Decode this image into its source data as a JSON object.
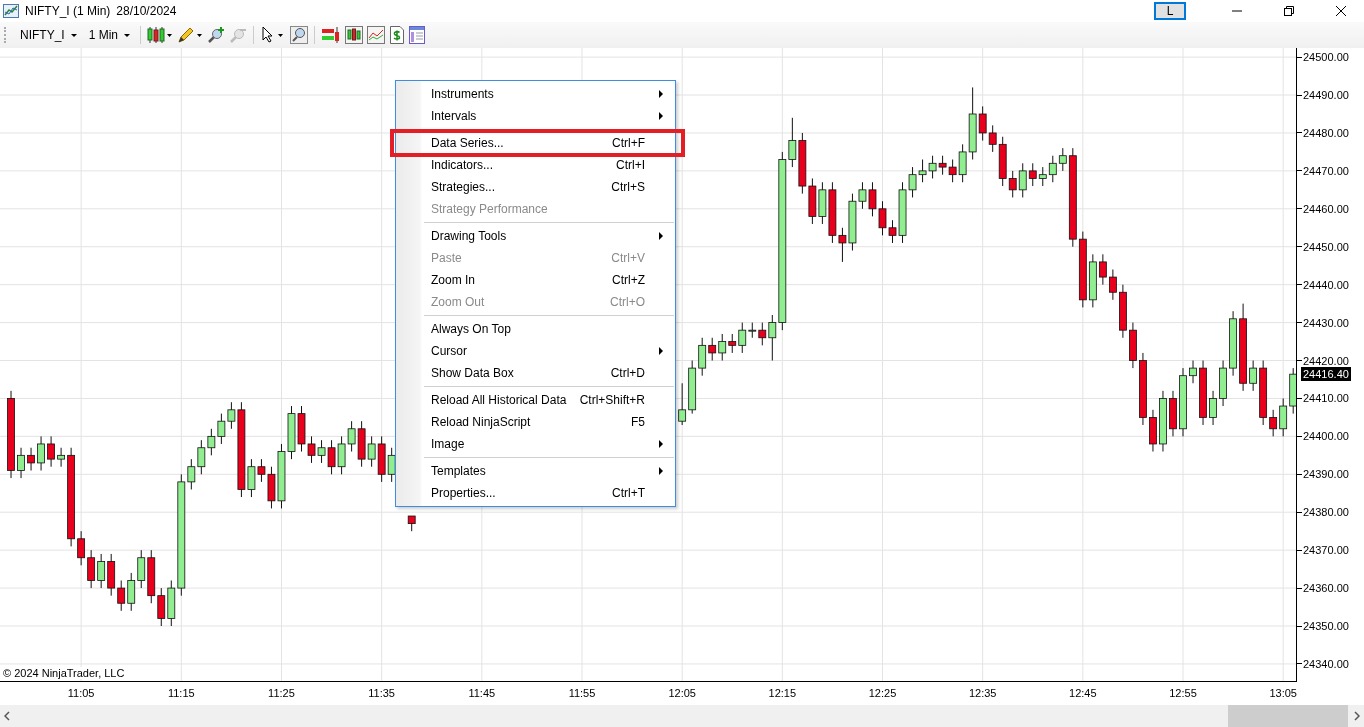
{
  "window": {
    "title": "NIFTY_I (1 Min)",
    "date": "28/10/2024",
    "account_button": "L"
  },
  "toolbar": {
    "instrument": "NIFTY_I",
    "interval": "1 Min"
  },
  "chart": {
    "current_price": "24416.40",
    "copyright": "© 2024 NinjaTrader, LLC",
    "chart_data": {
      "type": "candlestick",
      "x": [
        658,
        659,
        660,
        661,
        662,
        663,
        664,
        665,
        666,
        667,
        668,
        669,
        670,
        671,
        672,
        673,
        674,
        675,
        676,
        677,
        678,
        679,
        680,
        681,
        682,
        683,
        684,
        685,
        686,
        687,
        688,
        689,
        690,
        691,
        692,
        693,
        694,
        695,
        696,
        698,
        725,
        726,
        727,
        728,
        729,
        730,
        731,
        732,
        733,
        734,
        735,
        736,
        737,
        738,
        739,
        740,
        741,
        742,
        743,
        744,
        745,
        746,
        747,
        748,
        749,
        750,
        751,
        752,
        753,
        754,
        755,
        756,
        757,
        758,
        759,
        760,
        761,
        762,
        763,
        764,
        765,
        766,
        767,
        768,
        769,
        770,
        771,
        772,
        773,
        774,
        775,
        776,
        777,
        778,
        779,
        780,
        781,
        782,
        783,
        784,
        785,
        786
      ],
      "ohlc": [
        [
          24410,
          24412,
          24389,
          24391
        ],
        [
          24391,
          24397,
          24389,
          24395
        ],
        [
          24395,
          24397,
          24391,
          24393
        ],
        [
          24393,
          24400,
          24391,
          24398
        ],
        [
          24398,
          24400,
          24392,
          24394
        ],
        [
          24394,
          24397,
          24392,
          24395
        ],
        [
          24395,
          24397,
          24371,
          24373
        ],
        [
          24373,
          24375,
          24366,
          24368
        ],
        [
          24368,
          24370,
          24360,
          24362
        ],
        [
          24362,
          24369,
          24360,
          24367
        ],
        [
          24367,
          24369,
          24358,
          24360
        ],
        [
          24360,
          24362,
          24354,
          24356
        ],
        [
          24356,
          24364,
          24354,
          24362
        ],
        [
          24362,
          24370,
          24360,
          24368
        ],
        [
          24368,
          24370,
          24356,
          24358
        ],
        [
          24358,
          24360,
          24350,
          24352
        ],
        [
          24352,
          24362,
          24350,
          24360
        ],
        [
          24360,
          24390,
          24358,
          24388
        ],
        [
          24388,
          24394,
          24386,
          24392
        ],
        [
          24392,
          24399,
          24390,
          24397
        ],
        [
          24397,
          24402,
          24395,
          24400
        ],
        [
          24400,
          24406,
          24398,
          24404
        ],
        [
          24404,
          24409,
          24402,
          24407
        ],
        [
          24407,
          24409,
          24384,
          24386
        ],
        [
          24386,
          24394,
          24384,
          24392
        ],
        [
          24392,
          24394,
          24388,
          24390
        ],
        [
          24390,
          24392,
          24381,
          24383
        ],
        [
          24383,
          24398,
          24381,
          24396
        ],
        [
          24396,
          24408,
          24394,
          24406
        ],
        [
          24406,
          24408,
          24396,
          24398
        ],
        [
          24398,
          24400,
          24393,
          24395
        ],
        [
          24395,
          24399,
          24393,
          24397
        ],
        [
          24397,
          24399,
          24390,
          24392
        ],
        [
          24392,
          24400,
          24390,
          24398
        ],
        [
          24398,
          24404,
          24396,
          24402
        ],
        [
          24402,
          24404,
          24392,
          24394
        ],
        [
          24394,
          24400,
          24392,
          24398
        ],
        [
          24398,
          24400,
          24388,
          24390
        ],
        [
          24390,
          24397,
          24388,
          24395
        ],
        [
          24379,
          24379,
          24375,
          24377
        ],
        [
          24404,
          24414,
          24403,
          24407
        ],
        [
          24407,
          24420,
          24406,
          24418
        ],
        [
          24418,
          24426,
          24416,
          24424
        ],
        [
          24424,
          24426,
          24420,
          24422
        ],
        [
          24422,
          24427,
          24420,
          24425
        ],
        [
          24425,
          24427,
          24422,
          24424
        ],
        [
          24424,
          24430,
          24422,
          24428
        ],
        [
          24428,
          24430,
          24426,
          24428
        ],
        [
          24428,
          24430,
          24424,
          24426
        ],
        [
          24426,
          24432,
          24420,
          24430
        ],
        [
          24430,
          24475,
          24428,
          24473
        ],
        [
          24473,
          24484,
          24471,
          24478
        ],
        [
          24478,
          24480,
          24464,
          24466
        ],
        [
          24466,
          24468,
          24456,
          24458
        ],
        [
          24458,
          24467,
          24456,
          24465
        ],
        [
          24465,
          24467,
          24451,
          24453
        ],
        [
          24453,
          24455,
          24446,
          24451
        ],
        [
          24451,
          24464,
          24449,
          24462
        ],
        [
          24462,
          24467,
          24460,
          24465
        ],
        [
          24465,
          24467,
          24458,
          24460
        ],
        [
          24460,
          24462,
          24453,
          24455
        ],
        [
          24455,
          24457,
          24451,
          24453
        ],
        [
          24453,
          24467,
          24451,
          24465
        ],
        [
          24465,
          24471,
          24463,
          24469
        ],
        [
          24469,
          24473,
          24467,
          24470
        ],
        [
          24470,
          24474,
          24468,
          24472
        ],
        [
          24472,
          24474,
          24469,
          24471
        ],
        [
          24471,
          24473,
          24467,
          24469
        ],
        [
          24469,
          24477,
          24467,
          24475
        ],
        [
          24475,
          24492,
          24473,
          24485
        ],
        [
          24485,
          24487,
          24478,
          24480
        ],
        [
          24480,
          24482,
          24475,
          24477
        ],
        [
          24477,
          24479,
          24466,
          24468
        ],
        [
          24468,
          24470,
          24463,
          24465
        ],
        [
          24465,
          24472,
          24463,
          24470
        ],
        [
          24470,
          24472,
          24466,
          24468
        ],
        [
          24468,
          24471,
          24466,
          24469
        ],
        [
          24469,
          24474,
          24467,
          24472
        ],
        [
          24472,
          24476,
          24470,
          24474
        ],
        [
          24474,
          24476,
          24450,
          24452
        ],
        [
          24452,
          24454,
          24434,
          24436
        ],
        [
          24436,
          24448,
          24434,
          24446
        ],
        [
          24446,
          24448,
          24440,
          24442
        ],
        [
          24442,
          24444,
          24436,
          24438
        ],
        [
          24438,
          24440,
          24426,
          24428
        ],
        [
          24428,
          24430,
          24418,
          24420
        ],
        [
          24420,
          24422,
          24403,
          24405
        ],
        [
          24405,
          24407,
          24396,
          24398
        ],
        [
          24398,
          24412,
          24396,
          24410
        ],
        [
          24410,
          24412,
          24400,
          24402
        ],
        [
          24402,
          24418,
          24400,
          24416
        ],
        [
          24416,
          24420,
          24414,
          24418
        ],
        [
          24418,
          24420,
          24403,
          24405
        ],
        [
          24405,
          24412,
          24403,
          24410
        ],
        [
          24410,
          24420,
          24408,
          24418
        ],
        [
          24418,
          24433,
          24416,
          24431
        ],
        [
          24431,
          24435,
          24412,
          24414
        ],
        [
          24414,
          24420,
          24412,
          24418
        ],
        [
          24418,
          24420,
          24403,
          24405
        ],
        [
          24405,
          24407,
          24400,
          24402
        ],
        [
          24402,
          24410,
          24400,
          24408
        ],
        [
          24408,
          24418,
          24406,
          24416.4
        ]
      ],
      "xlim": [
        656.9,
        786.38
      ],
      "ylim": [
        24335.5,
        24502.4
      ],
      "grid": true,
      "xticks": [
        {
          "value": 665,
          "label": "11:05"
        },
        {
          "value": 675,
          "label": "11:15"
        },
        {
          "value": 685,
          "label": "11:25"
        },
        {
          "value": 695,
          "label": "11:35"
        },
        {
          "value": 705,
          "label": "11:45"
        },
        {
          "value": 715,
          "label": "11:55"
        },
        {
          "value": 725,
          "label": "12:05"
        },
        {
          "value": 735,
          "label": "12:15"
        },
        {
          "value": 745,
          "label": "12:25"
        },
        {
          "value": 755,
          "label": "12:35"
        },
        {
          "value": 765,
          "label": "12:45"
        },
        {
          "value": 775,
          "label": "12:55"
        },
        {
          "value": 785,
          "label": "13:05"
        }
      ],
      "yticks": [
        {
          "value": 24500,
          "label": "24500.00"
        },
        {
          "value": 24490,
          "label": "24490.00"
        },
        {
          "value": 24480,
          "label": "24480.00"
        },
        {
          "value": 24470,
          "label": "24470.00"
        },
        {
          "value": 24460,
          "label": "24460.00"
        },
        {
          "value": 24450,
          "label": "24450.00"
        },
        {
          "value": 24440,
          "label": "24440.00"
        },
        {
          "value": 24430,
          "label": "24430.00"
        },
        {
          "value": 24420,
          "label": "24420.00"
        },
        {
          "value": 24410,
          "label": "24410.00"
        },
        {
          "value": 24400,
          "label": "24400.00"
        },
        {
          "value": 24390,
          "label": "24390.00"
        },
        {
          "value": 24380,
          "label": "24380.00"
        },
        {
          "value": 24370,
          "label": "24370.00"
        },
        {
          "value": 24360,
          "label": "24360.00"
        },
        {
          "value": 24350,
          "label": "24350.00"
        },
        {
          "value": 24340,
          "label": "24340.00"
        }
      ]
    }
  },
  "context_menu": {
    "sections": [
      [
        {
          "label": "Instruments",
          "submenu": true,
          "disabled": false,
          "highlighted": false
        },
        {
          "label": "Intervals",
          "submenu": true,
          "disabled": false,
          "highlighted": false
        }
      ],
      [
        {
          "label": "Data Series...",
          "shortcut": "Ctrl+F",
          "submenu": false,
          "disabled": false,
          "highlighted": true
        },
        {
          "label": "Indicators...",
          "shortcut": "Ctrl+I",
          "submenu": false,
          "disabled": false,
          "highlighted": false
        },
        {
          "label": "Strategies...",
          "shortcut": "Ctrl+S",
          "submenu": false,
          "disabled": false,
          "highlighted": false
        },
        {
          "label": "Strategy Performance",
          "submenu": false,
          "disabled": true,
          "highlighted": false
        }
      ],
      [
        {
          "label": "Drawing Tools",
          "submenu": true,
          "disabled": false,
          "highlighted": false
        },
        {
          "label": "Paste",
          "shortcut": "Ctrl+V",
          "submenu": false,
          "disabled": true,
          "highlighted": false
        },
        {
          "label": "Zoom In",
          "shortcut": "Ctrl+Z",
          "submenu": false,
          "disabled": false,
          "highlighted": false
        },
        {
          "label": "Zoom Out",
          "shortcut": "Ctrl+O",
          "submenu": false,
          "disabled": true,
          "highlighted": false
        }
      ],
      [
        {
          "label": "Always On Top",
          "submenu": false,
          "disabled": false,
          "highlighted": false
        },
        {
          "label": "Cursor",
          "submenu": true,
          "disabled": false,
          "highlighted": false
        },
        {
          "label": "Show Data Box",
          "shortcut": "Ctrl+D",
          "submenu": false,
          "disabled": false,
          "highlighted": false
        }
      ],
      [
        {
          "label": "Reload All Historical Data",
          "shortcut": "Ctrl+Shift+R",
          "submenu": false,
          "disabled": false,
          "highlighted": false
        },
        {
          "label": "Reload NinjaScript",
          "shortcut": "F5",
          "submenu": false,
          "disabled": false,
          "highlighted": false
        },
        {
          "label": "Image",
          "submenu": true,
          "disabled": false,
          "highlighted": false
        }
      ],
      [
        {
          "label": "Templates",
          "submenu": true,
          "disabled": false,
          "highlighted": false
        },
        {
          "label": "Properties...",
          "shortcut": "Ctrl+T",
          "submenu": false,
          "disabled": false,
          "highlighted": false
        }
      ]
    ]
  }
}
